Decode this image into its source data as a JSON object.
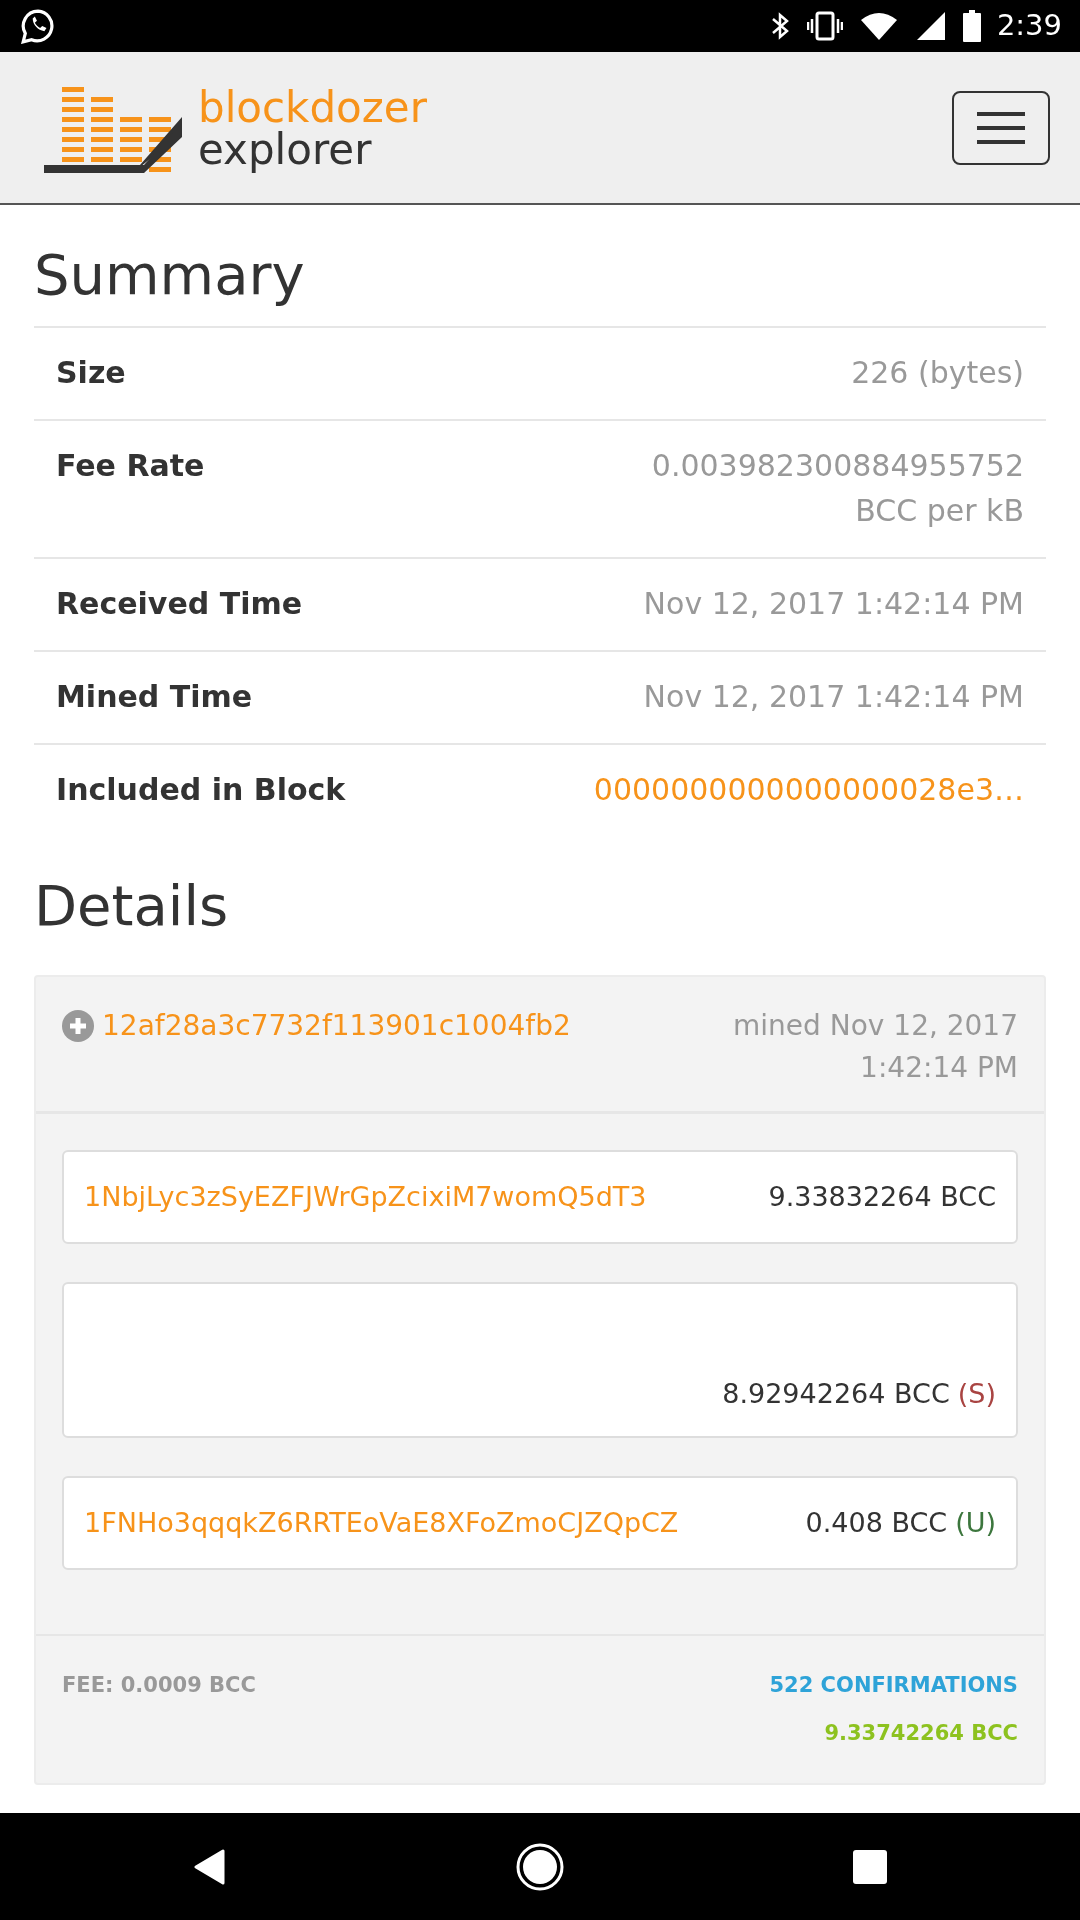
{
  "status_bar": {
    "time": "2:39"
  },
  "navbar": {
    "brand_top": "blockdozer",
    "brand_bottom": "explorer"
  },
  "summary": {
    "title": "Summary",
    "rows": [
      {
        "label": "Size",
        "value": "226 (bytes)",
        "kind": "text"
      },
      {
        "label": "Fee Rate",
        "value": "0.003982300884955752 BCC per kB",
        "kind": "text"
      },
      {
        "label": "Received Time",
        "value": "Nov 12, 2017 1:42:14 PM",
        "kind": "text"
      },
      {
        "label": "Mined Time",
        "value": "Nov 12, 2017 1:42:14 PM",
        "kind": "text"
      },
      {
        "label": "Included in Block",
        "value": "0000000000000000028e3…",
        "kind": "link"
      }
    ]
  },
  "details": {
    "title": "Details",
    "txid": "12af28a3c7732f113901c1004fb2",
    "mined": "mined Nov 12, 2017 1:42:14 PM",
    "outputs": [
      {
        "address": "1NbjLyc3zSyEZFJWrGpZcixiM7womQ5dT3",
        "amount": "9.33832264 BCC"
      },
      {
        "amount": "8.92942264 BCC",
        "flag": "(S)",
        "kind": "spent"
      },
      {
        "address": "1FNHo3qqqkZ6RRTEoVaE8XFoZmoCJZQpCZ",
        "amount": "0.408 BCC",
        "flag": "(U)",
        "kind": "unspent"
      }
    ],
    "fee": "FEE: 0.0009 BCC",
    "confirmations": "522 CONFIRMATIONS",
    "total": "9.33742264 BCC"
  }
}
